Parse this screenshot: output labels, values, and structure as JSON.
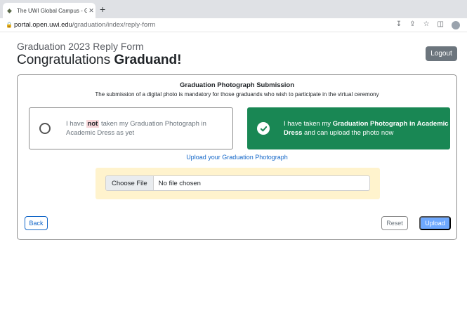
{
  "browser": {
    "tab_title": "The UWI Global Campus - Grad",
    "new_tab_symbol": "+",
    "url_host": "portal.open.uwi.edu",
    "url_path": "/graduation/index/reply-form",
    "icons": [
      "lock-icon",
      "download-icon",
      "share-icon",
      "star-icon",
      "sidepanel-icon",
      "profile-icon"
    ]
  },
  "header": {
    "subtitle": "Graduation 2023 Reply Form",
    "title_prefix": "Congratulations ",
    "title_bold": "Graduand!",
    "logout_label": "Logout"
  },
  "card": {
    "heading": "Graduation Photograph Submission",
    "subheading": "The submission of a digital photo is mandatory for those graduands who wish to participate in the virtual ceremony",
    "option_not": {
      "text_before": "I have ",
      "highlight": "not",
      "text_after": " taken my Graduation Photograph in Academic Dress as yet",
      "selected": false
    },
    "option_yes": {
      "text_before": "I have taken my ",
      "bold": "Graduation Photograph in Academic Dress",
      "text_after": " and can upload the photo now",
      "selected": true
    },
    "upload_link": "Upload your Graduation Photograph",
    "file_input": {
      "button_label": "Choose File",
      "status": "No file chosen"
    },
    "buttons": {
      "back": "Back",
      "reset": "Reset",
      "upload": "Upload"
    }
  },
  "colors": {
    "success": "#198754",
    "primary": "#1266c8",
    "upload_disabled": "#6ea8fe",
    "warning_bg": "#fff3cd",
    "danger_bg": "#f8d7da",
    "secondary": "#6c757d"
  }
}
